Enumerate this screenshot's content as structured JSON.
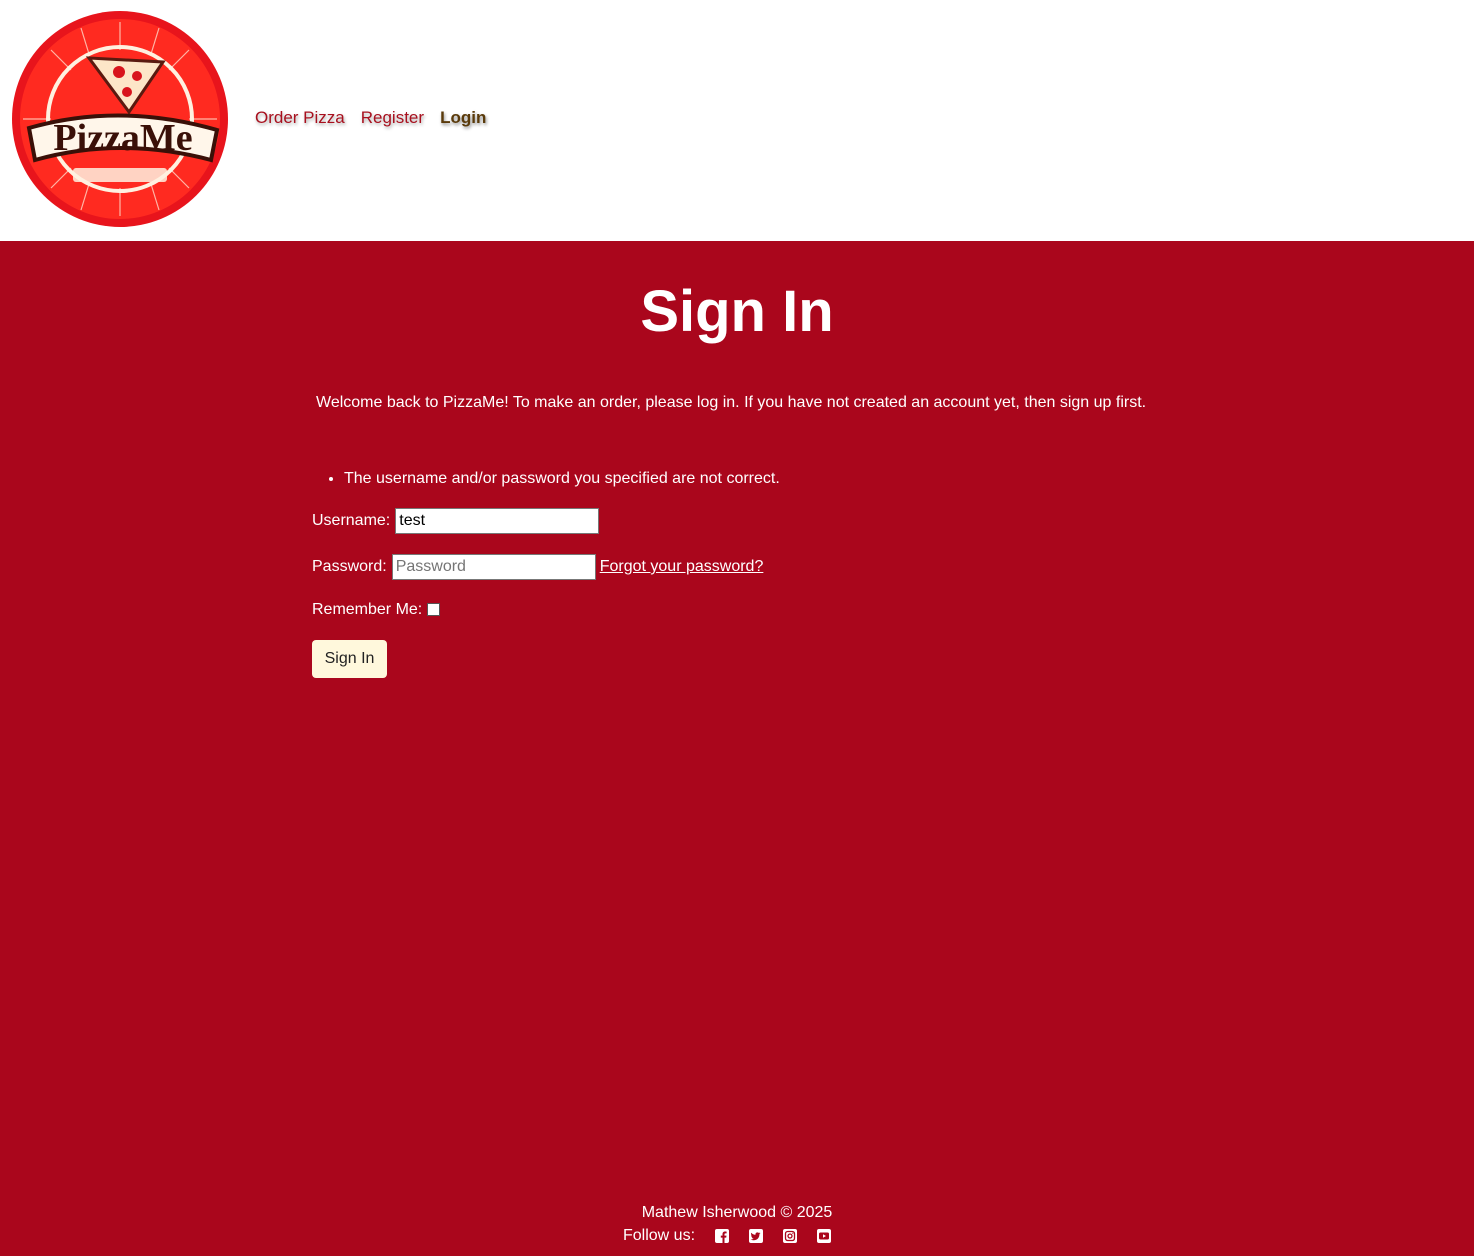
{
  "header": {
    "logo_alt": "PizzaMe",
    "nav": [
      {
        "label": "Order Pizza",
        "active": false
      },
      {
        "label": "Register",
        "active": false
      },
      {
        "label": "Login",
        "active": true
      }
    ]
  },
  "main": {
    "title": "Sign In",
    "welcome": "Welcome back to PizzaMe! To make an order, please log in. If you have not created an account yet, then sign up first.",
    "errors": [
      "The username and/or password you specified are not correct."
    ],
    "form": {
      "username_label": "Username:",
      "username_value": "test",
      "password_label": "Password:",
      "password_placeholder": "Password",
      "forgot_label": "Forgot your password?",
      "remember_label": "Remember Me:",
      "remember_checked": false,
      "submit_label": "Sign In"
    }
  },
  "footer": {
    "copyright": "Mathew Isherwood © 2025",
    "follow_label": "Follow us:",
    "social": [
      "facebook-icon",
      "twitter-icon",
      "instagram-icon",
      "youtube-icon"
    ]
  },
  "colors": {
    "background": "#aa061c",
    "nav_link": "#a8101e",
    "nav_active": "#5a3a0a",
    "button_bg": "#fff8dc"
  }
}
